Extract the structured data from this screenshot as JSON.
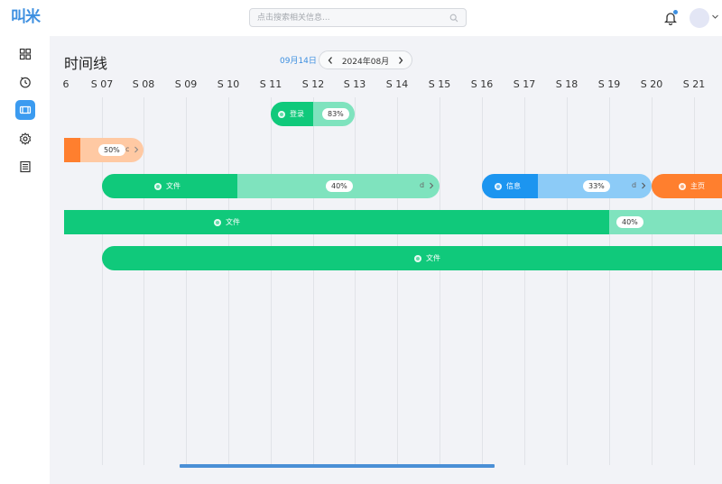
{
  "header": {
    "search_placeholder": "点击搜索相关信息...",
    "logo_text": "叫米"
  },
  "sidebar": {
    "items": [
      {
        "name": "dashboard",
        "icon": "grid-icon",
        "active": false
      },
      {
        "name": "timer",
        "icon": "timer-icon",
        "active": false
      },
      {
        "name": "timeline",
        "icon": "timeline-icon",
        "active": true
      },
      {
        "name": "settings",
        "icon": "gear-icon",
        "active": false
      },
      {
        "name": "document",
        "icon": "document-icon",
        "active": false
      }
    ]
  },
  "page": {
    "title": "时间线",
    "today_label": "09月14日",
    "month_label": "2024年08月"
  },
  "timeline": {
    "days": [
      "6",
      "S 07",
      "S 08",
      "S 09",
      "S 10",
      "S 11",
      "S 12",
      "S 13",
      "S 14",
      "S 15",
      "S 16",
      "S 17",
      "S 18",
      "S 19",
      "S 20",
      "S 21"
    ],
    "tasks": [
      {
        "label": "登录",
        "progress": "83%",
        "color": "#10c97b",
        "light": "#7fe3be",
        "tail": ""
      },
      {
        "label": "",
        "progress": "50%",
        "color": "#ff7f2e",
        "light": "#ffc9a3",
        "tail": "c"
      },
      {
        "label": "文件",
        "progress": "40%",
        "color": "#10c97b",
        "light": "#7fe3be",
        "tail": "d"
      },
      {
        "label": "信息",
        "progress": "33%",
        "color": "#1c95f0",
        "light": "#8ccbf7",
        "tail": "d"
      },
      {
        "label": "主页",
        "progress": "",
        "color": "#ff7f2e",
        "light": "#ffc9a3",
        "tail": ""
      },
      {
        "label": "文件",
        "progress": "40%",
        "color": "#10c97b",
        "light": "#7fe3be",
        "tail": ""
      },
      {
        "label": "文件",
        "progress": "",
        "color": "#10c97b",
        "light": "#7fe3be",
        "tail": ""
      }
    ]
  },
  "colors": {
    "accent": "#3d8fe0",
    "green": "#10c97b",
    "orange": "#ff7f2e",
    "blue": "#1c95f0"
  }
}
